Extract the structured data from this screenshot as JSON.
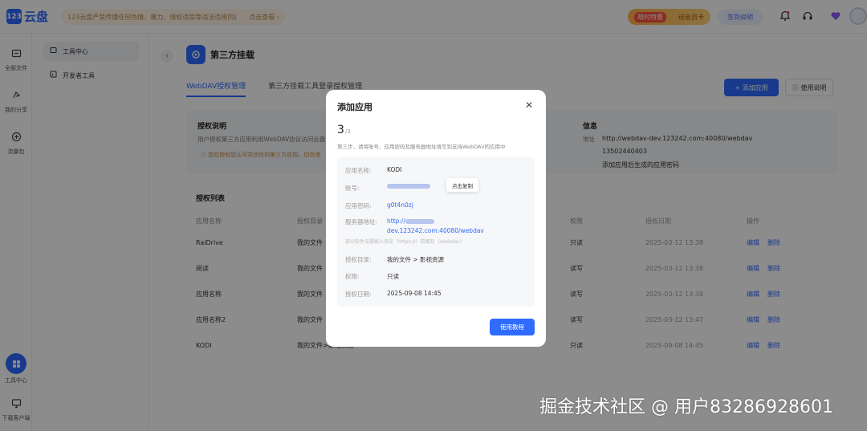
{
  "topbar": {
    "logo_box": "123",
    "logo_text": "云盘",
    "notice": "123云盘严禁传播任何色情、暴力、侵权违禁等违法违规内容",
    "notice_link": "点击查看 ›",
    "promo_tag": "限时特惠",
    "promo_right": "送会员卡",
    "sign_label": "签到说明",
    "icons": [
      "bell-icon",
      "headset-icon",
      "heart-icon"
    ]
  },
  "leftnav": [
    {
      "icon": "folder-icon",
      "label": "全部文件"
    },
    {
      "icon": "share-icon",
      "label": "我的分享"
    },
    {
      "icon": "traffic-icon",
      "label": "流量包"
    },
    {
      "icon": "grid-icon",
      "label": "工具中心"
    },
    {
      "icon": "monitor-icon",
      "label": "下载客户端"
    }
  ],
  "subnav": [
    {
      "icon": "box-icon",
      "label": "工具中心"
    },
    {
      "icon": "code-icon",
      "label": "开发者工具"
    }
  ],
  "page": {
    "title": "第三方挂载",
    "tabs": [
      "WebDAV授权管理",
      "第三方挂载工具登录授权管理"
    ],
    "add_button": "+ 添加应用",
    "help_button": "使用说明",
    "card": {
      "title": "授权说明",
      "desc": "用户授权第三方应用利用WebDAV协议访问云盘文件",
      "warn": "ⓘ 您应授权您认可并信任的第三方应用，切勿泄露",
      "right_title": "信息",
      "right_label": "地址",
      "server": "http://webdav-dev.123242.com:40080/webdav",
      "account": "13502440403",
      "password_note": "添加应用后生成的应用密码"
    },
    "list_title": "授权列表",
    "table": {
      "headers": [
        "应用名称",
        "授权目录",
        "应用密码",
        "权限",
        "授权日期",
        "操作"
      ],
      "rows": [
        {
          "name": "RaiDrive",
          "dir": "我的文件",
          "pwd": "",
          "perm": "只读",
          "date": "2025-03-12 13:38"
        },
        {
          "name": "阅读",
          "dir": "我的文件",
          "pwd": "",
          "perm": "读写",
          "date": "2025-03-12 13:38"
        },
        {
          "name": "应用名称",
          "dir": "我的文件",
          "pwd": "",
          "perm": "读写",
          "date": "2025-03-12 13:38"
        },
        {
          "name": "应用名称2",
          "dir": "我的文件",
          "pwd": "",
          "perm": "读写",
          "date": "2025-03-12 13:47"
        },
        {
          "name": "KODI",
          "dir": "我的文件>影视资源",
          "pwd": "**********",
          "perm": "只读",
          "date": "2025-09-08 14:45"
        }
      ],
      "op_edit": "编辑",
      "op_delete": "删除"
    }
  },
  "modal": {
    "title": "添加应用",
    "close": "✕",
    "step": "3",
    "step_total": "/3",
    "step_desc": "第三步，请将账号、应用密码及服务器地址填写到支持WebDAV的应用中",
    "fields": {
      "app_name_label": "应用名称:",
      "app_name": "KODI",
      "account_label": "账号:",
      "copy": "点击复制",
      "password_label": "应用密码:",
      "password": "g0t4n0zj",
      "server_label": "服务器地址:",
      "server_line1": "http://",
      "server_line2": "dev.123242.com:40080/webdav",
      "hint": "部分软件无需输入协议（https://）前缀及（/webdav）",
      "dir_label": "授权目录:",
      "dir": "我的文件 > 影视资源",
      "perm_label": "权限:",
      "perm": "只读",
      "date_label": "授权日期:",
      "date": "2025-09-08 14:45"
    },
    "tutorial": "使用教程"
  },
  "watermark": "掘金技术社区 @ 用户83286928601"
}
